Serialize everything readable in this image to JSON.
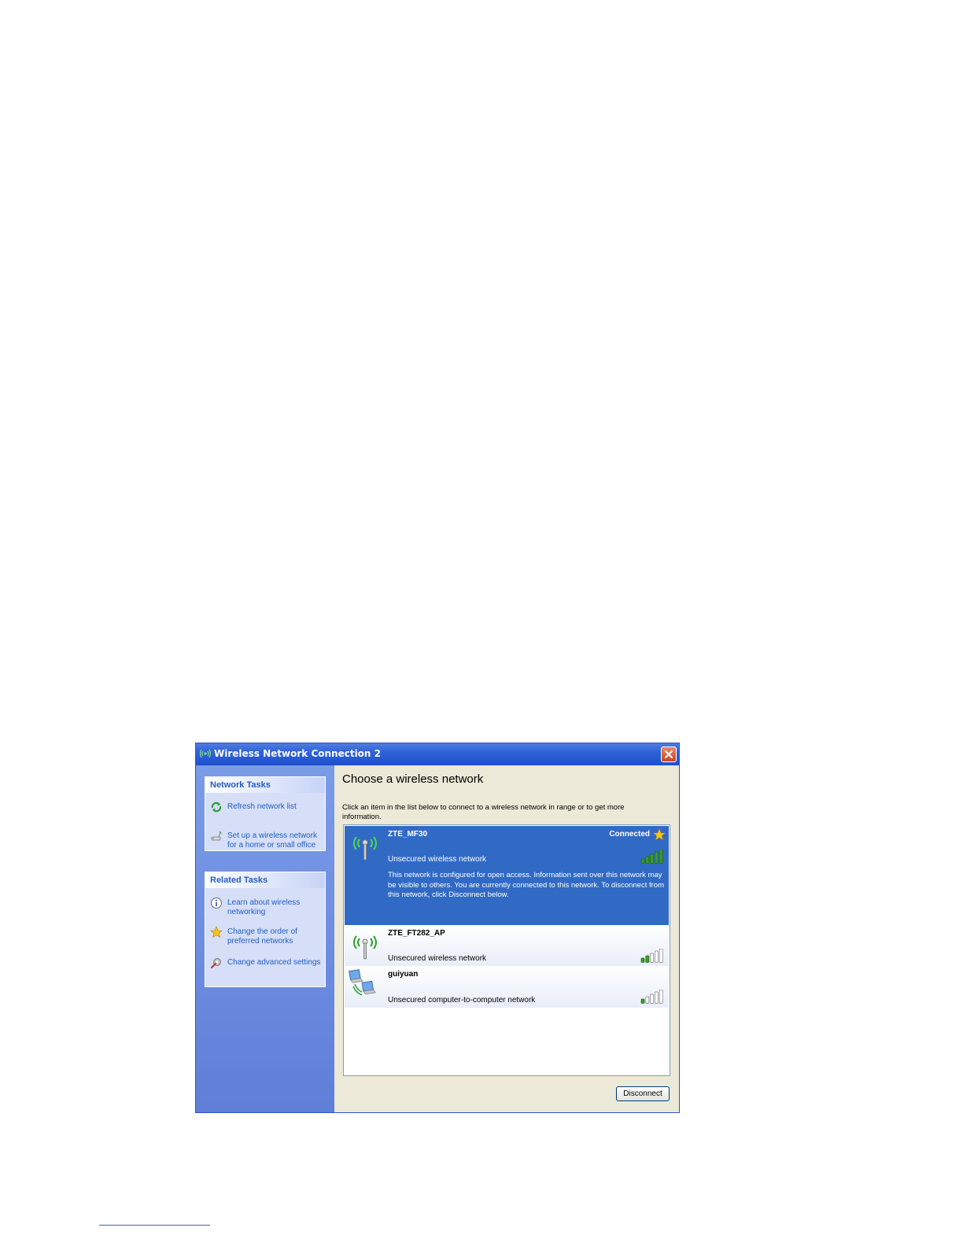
{
  "window": {
    "title": "Wireless Network Connection 2",
    "icon": "wireless-network-icon",
    "close": "close-icon"
  },
  "network_tasks": {
    "header": "Network Tasks",
    "items": [
      {
        "label": "Refresh network list",
        "icon": "refresh-icon"
      },
      {
        "label": "Set up a wireless network for a home or small office",
        "icon": "setup-wireless-icon"
      }
    ]
  },
  "related_tasks": {
    "header": "Related Tasks",
    "items": [
      {
        "label": "Learn about wireless networking",
        "icon": "info-icon"
      },
      {
        "label": "Change the order of preferred networks",
        "icon": "star-icon"
      },
      {
        "label": "Change advanced settings",
        "icon": "settings-icon"
      }
    ]
  },
  "main": {
    "heading": "Choose a wireless network",
    "instructions": "Click an item in the list below to connect to a wireless network in range or to get more information."
  },
  "networks": [
    {
      "name": "ZTE_MF30",
      "type": "Unsecured wireless network",
      "status": "Connected",
      "description": "This network is configured for open access. Information sent over this network may be visible to others. You are currently connected to this network. To disconnect from this network, click Disconnect below.",
      "signal_bars": 5,
      "selected": true,
      "icon": "wireless-antenna-icon"
    },
    {
      "name": "ZTE_FT282_AP",
      "type": "Unsecured wireless network",
      "signal_bars": 2,
      "selected": false,
      "icon": "wireless-antenna-icon"
    },
    {
      "name": "guiyuan",
      "type": "Unsecured computer-to-computer network",
      "signal_bars": 1,
      "selected": false,
      "icon": "computer-to-computer-icon"
    }
  ],
  "buttons": {
    "disconnect": "Disconnect"
  },
  "colors": {
    "selected_row": "#316ac5",
    "task_link": "#215dc6",
    "signal_green": "#3c9a2c",
    "titlebar": "#2f62d8"
  }
}
